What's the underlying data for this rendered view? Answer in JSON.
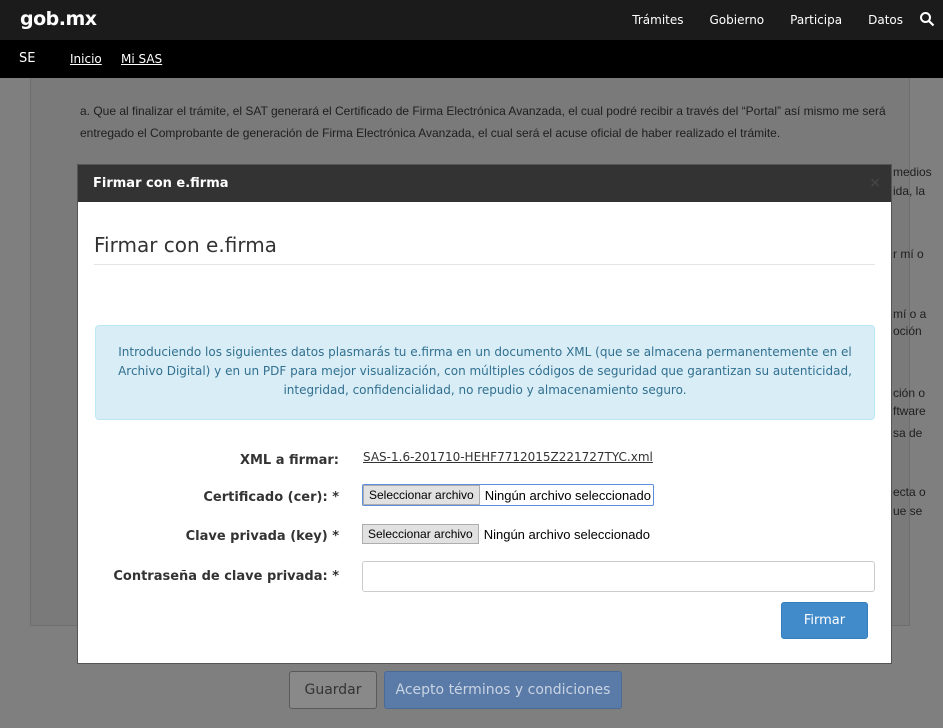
{
  "topbar": {
    "brand": "gob.mx",
    "nav": [
      "Trámites",
      "Gobierno",
      "Participa",
      "Datos"
    ]
  },
  "subbar": {
    "prefix": "SE",
    "links": [
      "Inicio",
      "Mi SAS"
    ]
  },
  "background": {
    "paragraph": "a. Que al finalizar el trámite, el SAT generará el Certificado de Firma Electrónica Avanzada, el cual podré recibir a través del “Portal” así mismo me será entregado el Comprobante de generación de Firma Electrónica Avanzada, el cual será el acuse oficial de haber realizado el trámite.",
    "edge_fragments": [
      "medios",
      "ida, la",
      "r mí o",
      "mí o a",
      "oción",
      "ción o",
      "ftware",
      "sa de",
      "ecta o",
      "ue se"
    ],
    "guardar_label": "Guardar",
    "acepto_label": "Acepto términos y condiciones"
  },
  "modal": {
    "header_title": "Firmar con e.firma",
    "close_glyph": "×",
    "heading": "Firmar con e.firma",
    "info_text": "Introduciendo los siguientes datos plasmarás tu e.firma en un documento XML (que se almacena permanentemente en el Archivo Digital) y en un PDF para mejor visualización, con múltiples códigos de seguridad que garantizan su autenticidad, integridad, confidencialidad, no repudio y almacenamiento seguro.",
    "xml_label": "XML a firmar:",
    "xml_file": "SAS-1.6-201710-HEHF7712015Z221727TYC.xml",
    "cer_label": "Certificado (cer): *",
    "key_label": "Clave privada (key) *",
    "pwd_label": "Contraseña de clave privada: *",
    "pwd_value": "",
    "file_button_label": "Seleccionar archivo",
    "file_empty_text": "Ningún archivo seleccionado",
    "submit_label": "Firmar"
  },
  "colors": {
    "info_bg": "#d9edf7",
    "info_text": "#31708f",
    "primary": "#428bca",
    "overlay": "#7f7f7f"
  }
}
